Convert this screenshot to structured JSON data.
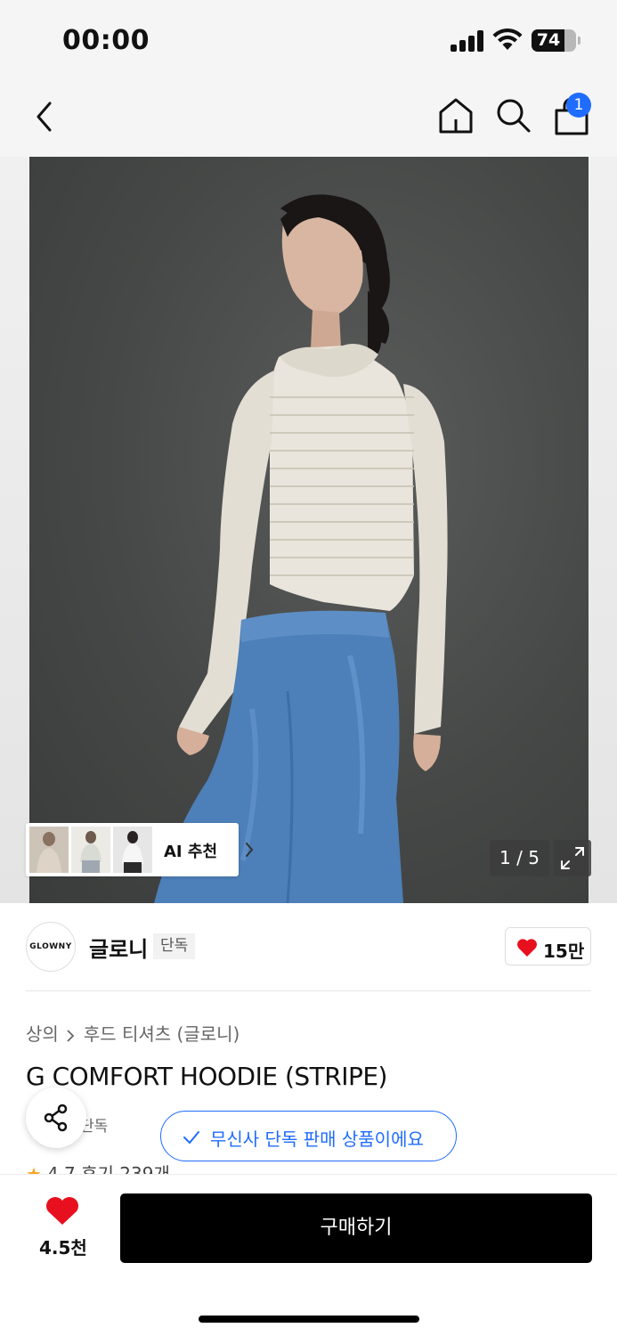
{
  "status_bar": {
    "time": "00:00",
    "battery": "74",
    "battery_level_pct": 74
  },
  "nav": {
    "cart_count": "1",
    "icons": [
      "back-icon",
      "home-icon",
      "search-icon",
      "shopping-bag-icon"
    ]
  },
  "gallery": {
    "counter": "1 / 5",
    "ai_label": "AI 추천",
    "thumbnail_count": 3
  },
  "brand": {
    "logo_text": "GLOWNY",
    "name": "글로니",
    "tag": "단독",
    "likes": "15만"
  },
  "product": {
    "breadcrumb": [
      "상의",
      "후드 티셔츠 (글로니)"
    ],
    "title": "G COMFORT HOODIE (STRIPE)",
    "exclusive_tag": "단독",
    "exclusive_notice": "무신사 단독 판매 상품이에요",
    "rating": "4.7",
    "reviews": "후기 239개"
  },
  "bottom_bar": {
    "wish_count": "4.5천",
    "buy_label": "구매하기"
  },
  "colors": {
    "accent_blue": "#1f6cff",
    "heart_red": "#e8101e",
    "star": "#f5a623",
    "buy_button": "#000000"
  }
}
